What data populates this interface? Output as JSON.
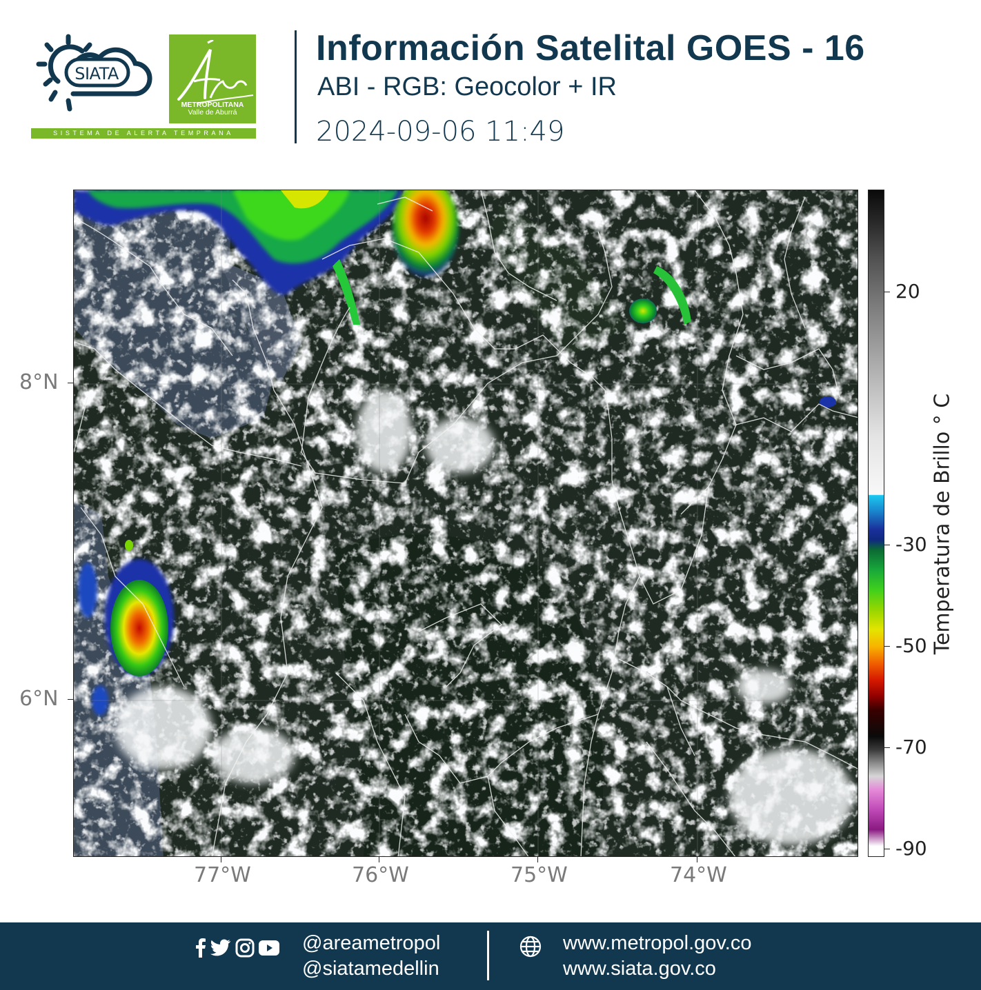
{
  "header": {
    "logo_siata": "SIATA",
    "logo_area_script": "Área",
    "logo_area_title": "METROPOLITANA",
    "logo_area_subtitle": "Valle de Aburrá",
    "tagline": "SISTEMA DE ALERTA TEMPRANA",
    "title": "Información Satelital GOES - 16",
    "subtitle": "ABI - RGB: Geocolor + IR",
    "timestamp": "2024-09-06 11:49"
  },
  "map": {
    "latitude_labels": [
      "8°N",
      "6°N"
    ],
    "longitude_labels": [
      "77°W",
      "76°W",
      "75°W",
      "74°W"
    ],
    "colors": {
      "land": "#1f2a22",
      "cloud": "#f4f6f7",
      "ocean": "#3d4a59",
      "borders": "#f2f2f2"
    }
  },
  "colorbar": {
    "title": "Temperatura de Brillo ° C",
    "ticks": [
      "20",
      "-30",
      "-50",
      "-70",
      "-90"
    ],
    "tick_values": [
      20,
      -30,
      -50,
      -70,
      -90
    ]
  },
  "footer": {
    "social_icons": [
      "facebook-icon",
      "twitter-icon",
      "instagram-icon",
      "youtube-icon"
    ],
    "handle_1": "@areametropol",
    "handle_2": "@siatamedellin",
    "website_1": "www.metropol.gov.co",
    "website_2": "www.siata.gov.co",
    "background": "#12384f"
  }
}
